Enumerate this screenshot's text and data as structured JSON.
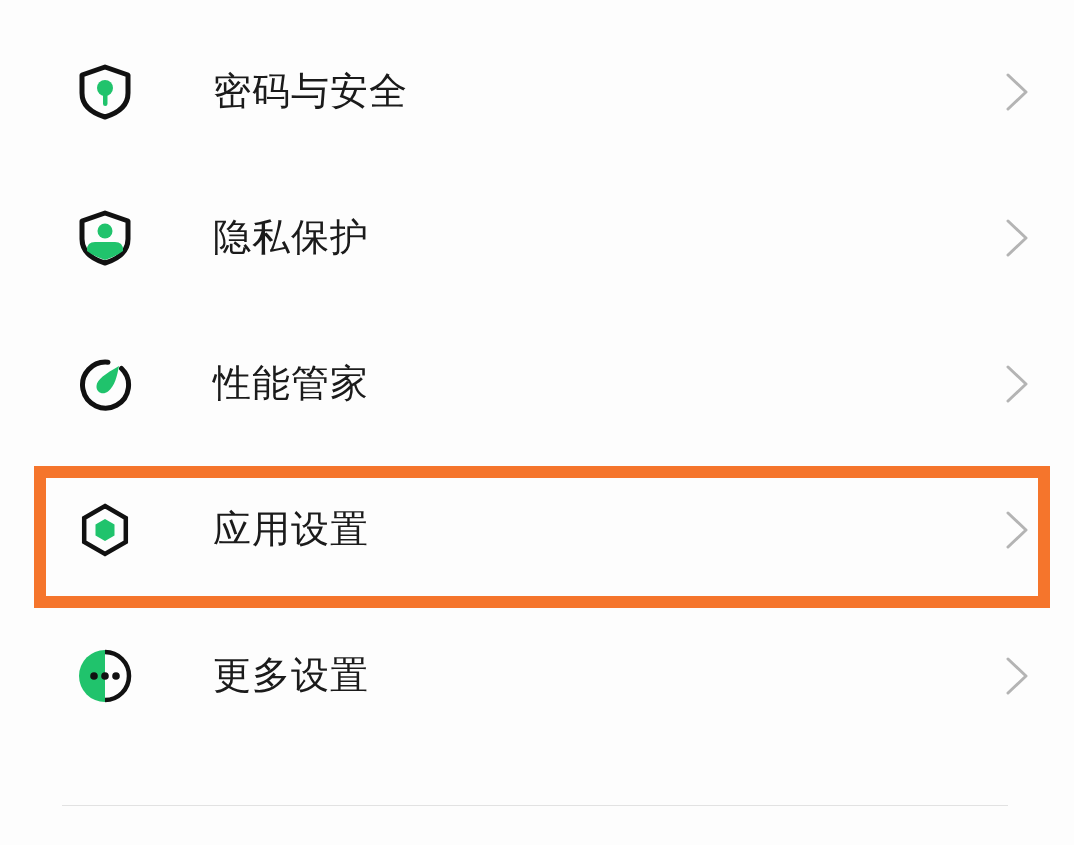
{
  "items": [
    {
      "label": "密码与安全",
      "kind": "shield-keyhole",
      "highlighted": false
    },
    {
      "label": "隐私保护",
      "kind": "shield-person",
      "highlighted": false
    },
    {
      "label": "性能管家",
      "kind": "gauge",
      "highlighted": false
    },
    {
      "label": "应用设置",
      "kind": "hexagon",
      "highlighted": true
    },
    {
      "label": "更多设置",
      "kind": "dots-circle",
      "highlighted": false
    }
  ]
}
